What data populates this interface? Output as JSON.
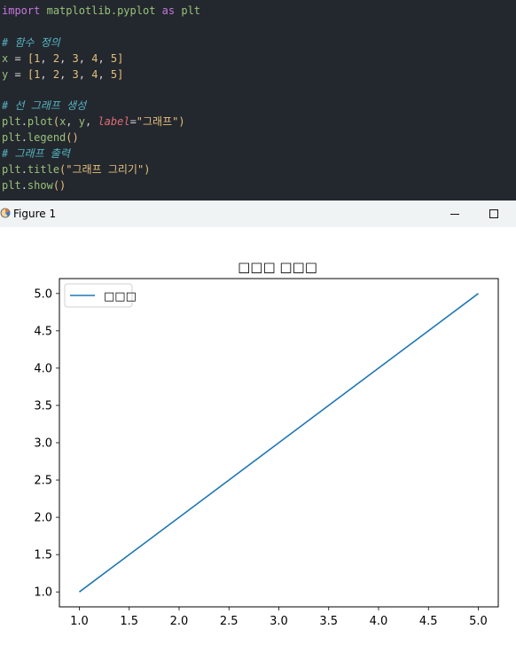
{
  "editor": {
    "l1": {
      "kw1": "import",
      "mod": "matplotlib.pyplot",
      "kw2": "as",
      "alias": "plt"
    },
    "l3": {
      "comment": "# 함수 정의"
    },
    "l4": {
      "name": "x",
      "eq": "=",
      "lb": "[",
      "n1": "1",
      "n2": "2",
      "n3": "3",
      "n4": "4",
      "n5": "5",
      "rb": "]"
    },
    "l5": {
      "name": "y",
      "eq": "=",
      "lb": "[",
      "n1": "1",
      "n2": "2",
      "n3": "3",
      "n4": "4",
      "n5": "5",
      "rb": "]"
    },
    "l7": {
      "comment": "# 선 그래프 생성"
    },
    "l8": {
      "obj": "plt",
      "fn": "plot",
      "lp": "(",
      "a1": "x",
      "a2": "y",
      "kw": "label",
      "eq": "=",
      "str": "\"그래프\"",
      "rp": ")"
    },
    "l9": {
      "obj": "plt",
      "fn": "legend",
      "parens": "()"
    },
    "l10": {
      "comment": "# 그래프 출력"
    },
    "l11": {
      "obj": "plt",
      "fn": "title",
      "lp": "(",
      "str": "\"그래프 그리기\"",
      "rp": ")"
    },
    "l12": {
      "obj": "plt",
      "fn": "show",
      "parens": "()"
    }
  },
  "window": {
    "title": "Figure 1",
    "icon": "matplotlib-icon",
    "minimize_icon": "minimize-icon",
    "maximize_icon": "maximize-icon"
  },
  "chart_data": {
    "type": "line",
    "title": "□□□ □□□",
    "x": [
      1,
      2,
      3,
      4,
      5
    ],
    "series": [
      {
        "name": "□□□",
        "values": [
          1,
          2,
          3,
          4,
          5
        ],
        "color": "#1f77b4"
      }
    ],
    "x_ticks": [
      "1.0",
      "1.5",
      "2.0",
      "2.5",
      "3.0",
      "3.5",
      "4.0",
      "4.5",
      "5.0"
    ],
    "y_ticks": [
      "1.0",
      "1.5",
      "2.0",
      "2.5",
      "3.0",
      "3.5",
      "4.0",
      "4.5",
      "5.0"
    ],
    "xlim": [
      0.8,
      5.2
    ],
    "ylim": [
      0.8,
      5.2
    ],
    "grid": false,
    "legend_position": "upper-left"
  }
}
